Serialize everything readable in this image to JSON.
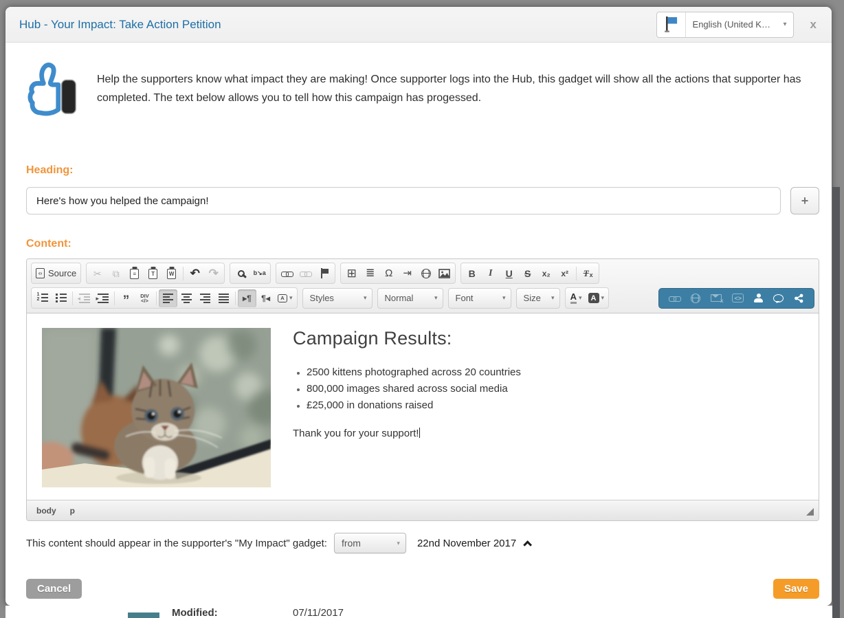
{
  "ui": {
    "caret_down": "▾"
  },
  "header": {
    "title": "Hub - Your Impact: Take Action Petition",
    "language_label": "English (United K…",
    "close_label": "x"
  },
  "intro": {
    "text": "Help the supporters know what impact they are making! Once supporter logs into the Hub, this gadget will show all the actions that supporter has completed. The text below allows you to tell how this campaign has progessed."
  },
  "heading_field": {
    "label": "Heading:",
    "value": "Here's how you helped the campaign!",
    "add_button_label": "+"
  },
  "content_field": {
    "label": "Content:"
  },
  "editor": {
    "source_label": "Source",
    "combos": {
      "styles": "Styles",
      "format": "Normal",
      "font": "Font",
      "size": "Size"
    },
    "glyphs": {
      "cut": "✂",
      "copy": "⧉",
      "paste_plain": "≡",
      "paste_text": "T",
      "paste_word": "W",
      "undo": "↶",
      "redo": "↷",
      "replace": "b↘a",
      "table": "⊞",
      "horizontal_rule": "≣",
      "special_char": "Ω",
      "page_break": "⇥",
      "bold": "B",
      "italic": "I",
      "underline": "U",
      "strike": "S",
      "subscript": "x₂",
      "superscript": "x²",
      "remove_format_t": "T",
      "remove_format_x": "x",
      "blockquote": "”",
      "div_top": "DIV",
      "div_bottom": "</>",
      "bidi_ltr": "▸¶",
      "bidi_rtl": "¶◂",
      "language_letter": "A",
      "embed": "<>",
      "font_color_letter": "A",
      "bg_color_letter": "A"
    },
    "document": {
      "heading": "Campaign Results:",
      "bullets": [
        "2500 kittens photographed across 20 countries",
        "800,000 images shared across social media",
        "£25,000 in donations raised"
      ],
      "closing": "Thank you for your support!"
    },
    "path_items": {
      "body": "body",
      "p": "p"
    }
  },
  "schedule": {
    "label": "This content should appear in the supporter's \"My Impact\" gadget:",
    "select_value": "from",
    "date": "22nd November 2017"
  },
  "actions": {
    "cancel": "Cancel",
    "save": "Save"
  },
  "background_page": {
    "modified_label": "Modified:",
    "modified_value": "07/11/2017"
  },
  "colors": {
    "title_blue": "#1d6ea6",
    "label_orange": "#f0953c",
    "save_orange": "#f59c28",
    "cancel_gray": "#9d9d9d",
    "toolbar_blue_group": "#3d7fa4",
    "flag_blue": "#3e86c6"
  }
}
